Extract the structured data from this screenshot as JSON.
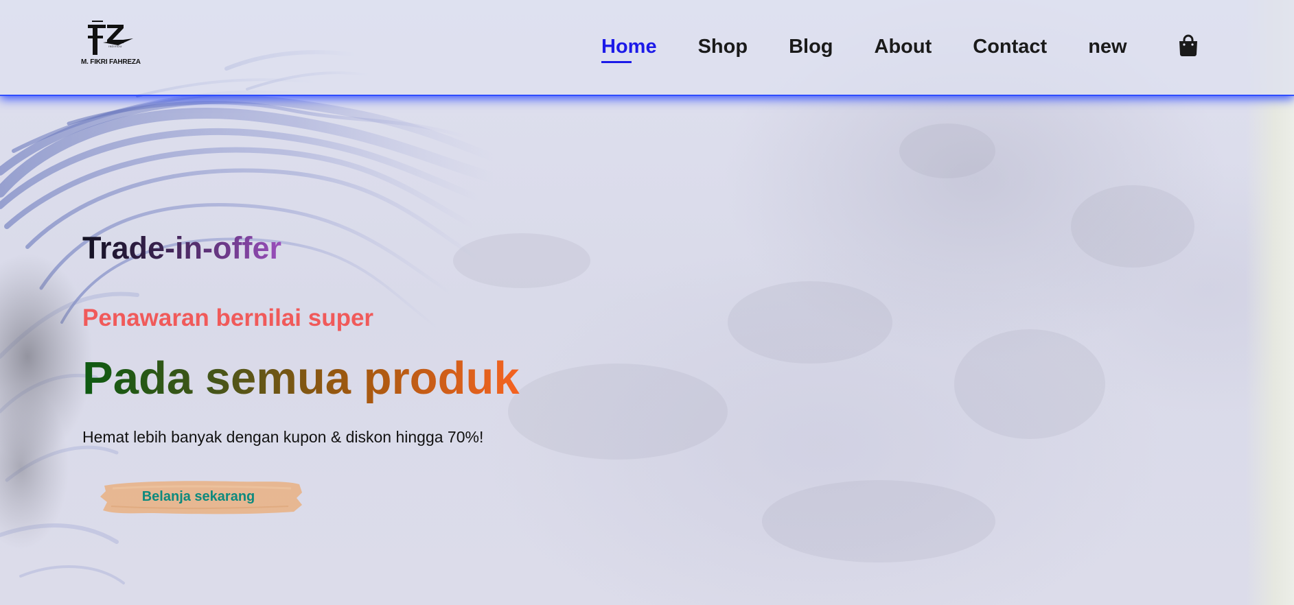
{
  "brand": {
    "logo_text": "FZ",
    "logo_sub": "INDVIDU",
    "name": "M. FIKRI FAHREZA"
  },
  "nav": {
    "items": [
      {
        "label": "Home",
        "active": true
      },
      {
        "label": "Shop",
        "active": false
      },
      {
        "label": "Blog",
        "active": false
      },
      {
        "label": "About",
        "active": false
      },
      {
        "label": "Contact",
        "active": false
      },
      {
        "label": "new",
        "active": false
      }
    ],
    "cart_icon": "shopping-bag-icon",
    "active_color": "#1c1ae8"
  },
  "hero": {
    "kicker": "Trade-in-offer",
    "subtitle": "Penawaran bernilai super",
    "title": "Pada semua produk",
    "description": "Hemat lebih banyak dengan kupon & diskon hingga 70%!",
    "cta_label": "Belanja sekarang"
  },
  "colors": {
    "header_glow": "#2c48ff",
    "subtitle": "#f05a5a",
    "title_gradient": [
      "#0d5a12",
      "#45551a",
      "#a1580f",
      "#f56321"
    ],
    "cta_bg": "#e8b48a",
    "cta_text": "#0d8a7e"
  }
}
